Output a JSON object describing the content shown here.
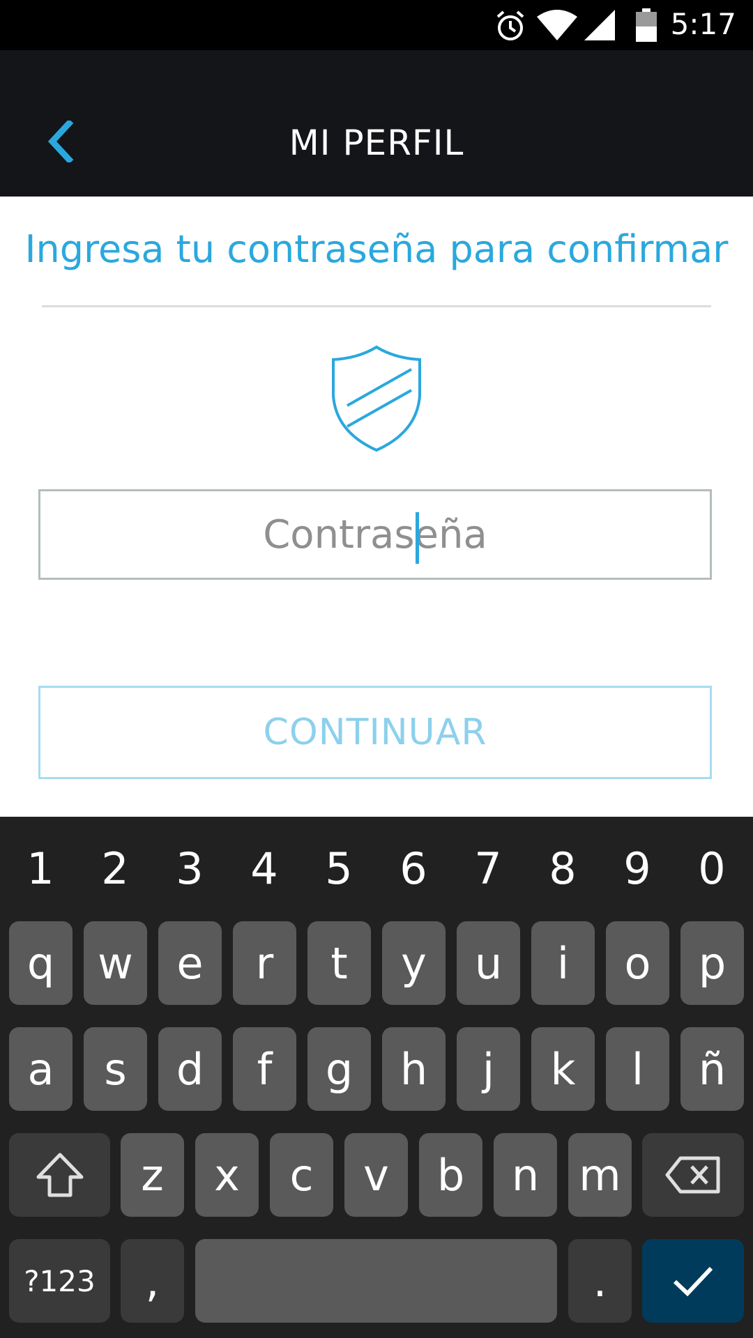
{
  "status_bar": {
    "time": "5:17",
    "icons": [
      "alarm-icon",
      "wifi-icon",
      "signal-icon",
      "battery-icon"
    ]
  },
  "header": {
    "title": "MI PERFIL",
    "back_icon": "chevron-left-icon"
  },
  "main": {
    "prompt": "Ingresa tu contraseña para confirmar",
    "icon": "shield-icon",
    "password_placeholder": "Contraseña",
    "password_value": "",
    "continue_label": "CONTINUAR"
  },
  "keyboard": {
    "numbers": [
      "1",
      "2",
      "3",
      "4",
      "5",
      "6",
      "7",
      "8",
      "9",
      "0"
    ],
    "row1": [
      "q",
      "w",
      "e",
      "r",
      "t",
      "y",
      "u",
      "i",
      "o",
      "p"
    ],
    "row2": [
      "a",
      "s",
      "d",
      "f",
      "g",
      "h",
      "j",
      "k",
      "l",
      "ñ"
    ],
    "row3": [
      "z",
      "x",
      "c",
      "v",
      "b",
      "n",
      "m"
    ],
    "symbols_label": "?123",
    "comma": ",",
    "period": ".",
    "shift_icon": "shift-icon",
    "backspace_icon": "backspace-icon",
    "enter_icon": "check-icon"
  },
  "colors": {
    "accent": "#2aa8dd",
    "app_bar": "#141519",
    "keyboard_bg": "#212121",
    "key_bg": "#5a5a5a",
    "enter_key": "#003b5c"
  }
}
